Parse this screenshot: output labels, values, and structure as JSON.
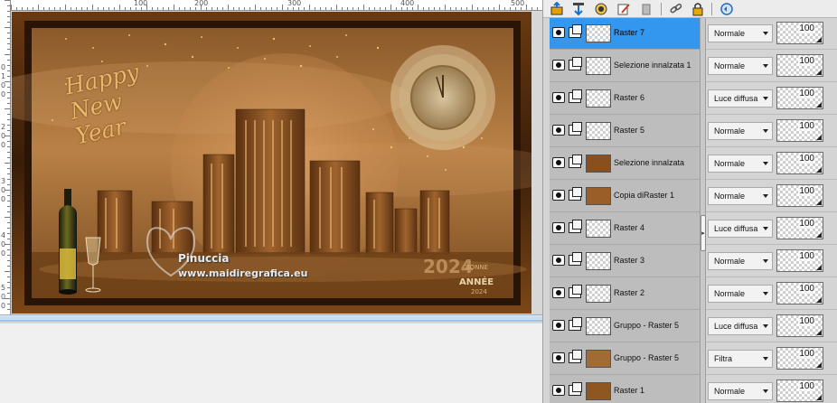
{
  "canvas": {
    "ruler_top_labels": [
      "100",
      "200",
      "300",
      "400",
      "500"
    ],
    "ruler_left_labels": [
      "0",
      "1",
      "0",
      "0",
      "2",
      "0",
      "0",
      "3",
      "0",
      "0",
      "4",
      "0",
      "0",
      "5",
      "0",
      "0"
    ],
    "artwork": {
      "greeting": "Happy New Year",
      "watermark_name": "Pinuccia",
      "watermark_url": "www.maidiregrafica.eu",
      "year": "2024",
      "bonne": "BONNE",
      "annee": "ANNÉE",
      "year_small": "2024",
      "colors": {
        "bronze": "#b0733a",
        "dark_frame": "#3a1d08",
        "gold": "#e8c27a"
      }
    }
  },
  "panel": {
    "toolbar": [
      {
        "icon": "new-layer-icon"
      },
      {
        "icon": "move-layer-icon"
      },
      {
        "icon": "mask-icon"
      },
      {
        "icon": "edit-icon"
      },
      {
        "icon": "delete-icon"
      },
      {
        "icon": "link-icon"
      },
      {
        "icon": "lock-icon"
      },
      {
        "icon": "properties-icon"
      }
    ],
    "layers": [
      {
        "name": "Raster 7",
        "mode": "Normale",
        "opacity": "100",
        "selected": true
      },
      {
        "name": "Selezione innalzata 1",
        "mode": "Normale",
        "opacity": "100",
        "selected": false
      },
      {
        "name": "Raster 6",
        "mode": "Luce diffusa",
        "opacity": "100",
        "selected": false
      },
      {
        "name": "Raster 5",
        "mode": "Normale",
        "opacity": "100",
        "selected": false
      },
      {
        "name": "Selezione innalzata",
        "mode": "Normale",
        "opacity": "100",
        "selected": false
      },
      {
        "name": "Copia diRaster 1",
        "mode": "Normale",
        "opacity": "100",
        "selected": false
      },
      {
        "name": "Raster 4",
        "mode": "Luce diffusa",
        "opacity": "100",
        "selected": false
      },
      {
        "name": "Raster 3",
        "mode": "Normale",
        "opacity": "100",
        "selected": false
      },
      {
        "name": "Raster 2",
        "mode": "Normale",
        "opacity": "100",
        "selected": false
      },
      {
        "name": "Gruppo - Raster 5",
        "mode": "Luce diffusa",
        "opacity": "100",
        "selected": false
      },
      {
        "name": "Gruppo - Raster 5",
        "mode": "Filtra",
        "opacity": "100",
        "selected": false
      },
      {
        "name": "Raster 1",
        "mode": "Normale",
        "opacity": "100",
        "selected": false
      }
    ],
    "colors": {
      "selection": "#3397f0"
    }
  }
}
